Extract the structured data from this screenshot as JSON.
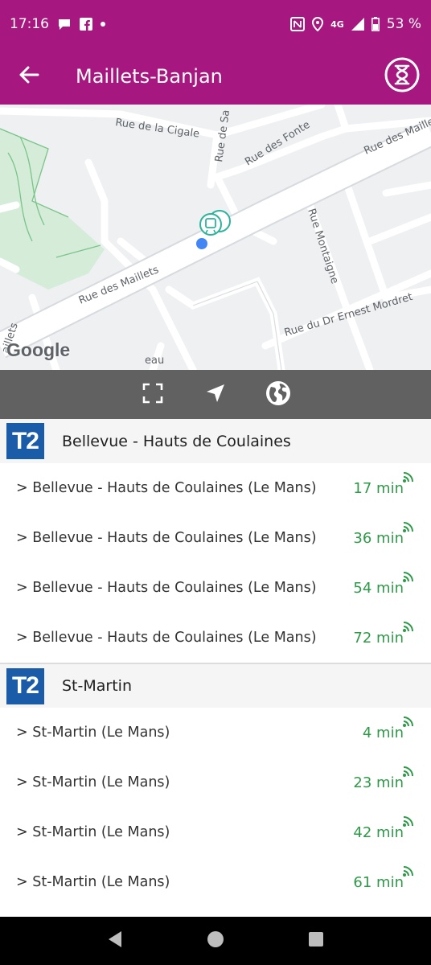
{
  "status_bar": {
    "time": "17:16",
    "network": "4G",
    "battery": "53 %"
  },
  "app_bar": {
    "title": "Maillets-Banjan"
  },
  "map": {
    "logo": "Google",
    "streets": {
      "cigale": "Rue de la Cigale",
      "maillets_left": "Rue des Maillets",
      "maillets_right": "Rue des Maillets",
      "fonte": "Rue des Fonte",
      "sa": "Rue de Sa",
      "montaigne": "Rue Montaigne",
      "mordret": "Rue du Dr Ernest Mordret",
      "eau": "eau",
      "maillets_edge": "aillets"
    }
  },
  "groups": [
    {
      "line": "T2",
      "direction": "Bellevue - Hauts de Coulaines",
      "departures": [
        {
          "destination": "> Bellevue - Hauts de Coulaines (Le Mans)",
          "time": "17 min"
        },
        {
          "destination": "> Bellevue - Hauts de Coulaines (Le Mans)",
          "time": "36 min"
        },
        {
          "destination": "> Bellevue - Hauts de Coulaines (Le Mans)",
          "time": "54 min"
        },
        {
          "destination": "> Bellevue - Hauts de Coulaines (Le Mans)",
          "time": "72 min"
        }
      ]
    },
    {
      "line": "T2",
      "direction": "St-Martin",
      "departures": [
        {
          "destination": "> St-Martin (Le Mans)",
          "time": "4 min"
        },
        {
          "destination": "> St-Martin (Le Mans)",
          "time": "23 min"
        },
        {
          "destination": "> St-Martin (Le Mans)",
          "time": "42 min"
        },
        {
          "destination": "> St-Martin (Le Mans)",
          "time": "61 min"
        }
      ]
    }
  ],
  "colors": {
    "brand": "#a6177f",
    "line_badge": "#1b5ca8",
    "realtime": "#2e9a48",
    "toolbar": "#616161"
  },
  "icons": {
    "back": "arrow-left-icon",
    "timer": "hourglass-icon",
    "fullscreen": "fullscreen-icon",
    "locate": "navigation-arrow-icon",
    "globe": "globe-icon",
    "realtime": "wifi-signal-icon"
  }
}
